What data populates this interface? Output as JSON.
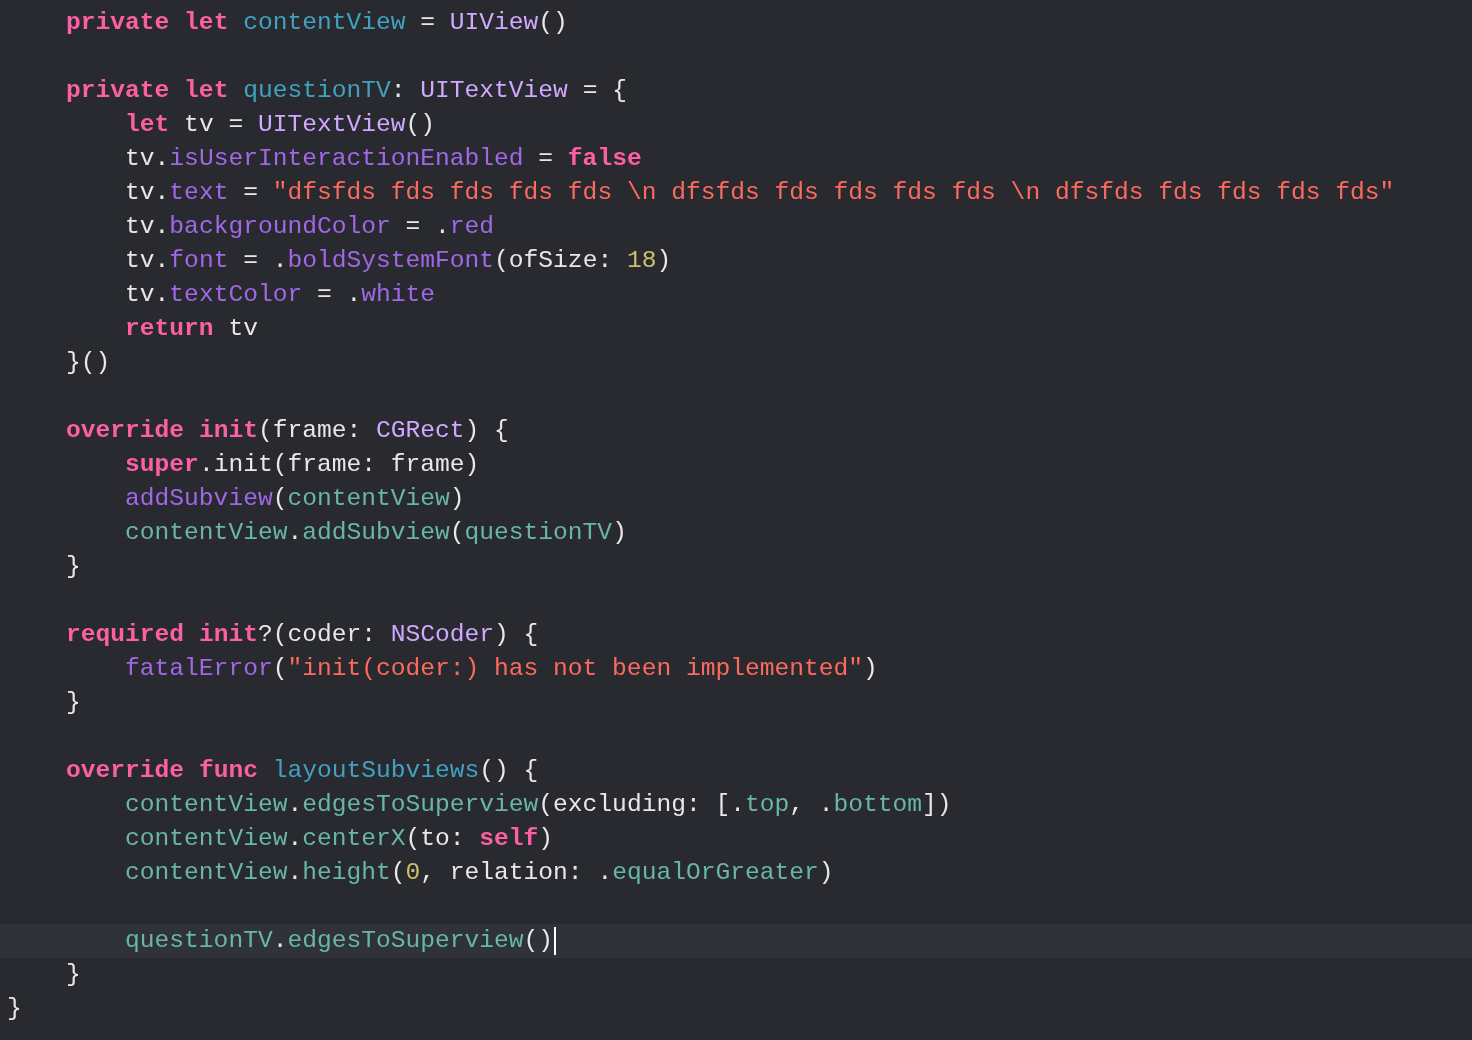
{
  "editor": {
    "lines": [
      {
        "current": false,
        "tokens": [
          {
            "kind": "keyword",
            "text": "    private "
          },
          {
            "kind": "keyword",
            "text": "let "
          },
          {
            "kind": "declaration",
            "text": "contentView"
          },
          {
            "kind": "plain",
            "text": " = "
          },
          {
            "kind": "type",
            "text": "UIView"
          },
          {
            "kind": "plain",
            "text": "()"
          }
        ]
      },
      {
        "current": false
      },
      {
        "current": false,
        "tokens": [
          {
            "kind": "keyword",
            "text": "    private "
          },
          {
            "kind": "keyword",
            "text": "let "
          },
          {
            "kind": "declaration",
            "text": "questionTV"
          },
          {
            "kind": "plain",
            "text": ": "
          },
          {
            "kind": "type",
            "text": "UITextView"
          },
          {
            "kind": "plain",
            "text": " = {"
          }
        ]
      },
      {
        "current": false,
        "tokens": [
          {
            "kind": "keyword",
            "text": "        let"
          },
          {
            "kind": "plain",
            "text": " tv = "
          },
          {
            "kind": "type",
            "text": "UITextView"
          },
          {
            "kind": "plain",
            "text": "()"
          }
        ]
      },
      {
        "current": false,
        "tokens": [
          {
            "kind": "plain",
            "text": "        tv."
          },
          {
            "kind": "system",
            "text": "isUserInteractionEnabled"
          },
          {
            "kind": "plain",
            "text": " = "
          },
          {
            "kind": "keyword",
            "text": "false"
          }
        ]
      },
      {
        "current": false,
        "tokens": [
          {
            "kind": "plain",
            "text": "        tv."
          },
          {
            "kind": "system",
            "text": "text"
          },
          {
            "kind": "plain",
            "text": " = "
          },
          {
            "kind": "string",
            "text": "\"dfsfds fds fds fds fds \\n dfsfds fds fds fds fds \\n dfsfds fds fds fds fds\""
          }
        ]
      },
      {
        "current": false,
        "tokens": [
          {
            "kind": "plain",
            "text": "        tv."
          },
          {
            "kind": "system",
            "text": "backgroundColor"
          },
          {
            "kind": "plain",
            "text": " = ."
          },
          {
            "kind": "system",
            "text": "red"
          }
        ]
      },
      {
        "current": false,
        "tokens": [
          {
            "kind": "plain",
            "text": "        tv."
          },
          {
            "kind": "system",
            "text": "font"
          },
          {
            "kind": "plain",
            "text": " = ."
          },
          {
            "kind": "system",
            "text": "boldSystemFont"
          },
          {
            "kind": "plain",
            "text": "(ofSize: "
          },
          {
            "kind": "number",
            "text": "18"
          },
          {
            "kind": "plain",
            "text": ")"
          }
        ]
      },
      {
        "current": false,
        "tokens": [
          {
            "kind": "plain",
            "text": "        tv."
          },
          {
            "kind": "system",
            "text": "textColor"
          },
          {
            "kind": "plain",
            "text": " = ."
          },
          {
            "kind": "system",
            "text": "white"
          }
        ]
      },
      {
        "current": false,
        "tokens": [
          {
            "kind": "keyword",
            "text": "        return"
          },
          {
            "kind": "plain",
            "text": " tv"
          }
        ]
      },
      {
        "current": false,
        "tokens": [
          {
            "kind": "plain",
            "text": "    }()"
          }
        ]
      },
      {
        "current": false
      },
      {
        "current": false,
        "tokens": [
          {
            "kind": "keyword",
            "text": "    override "
          },
          {
            "kind": "keyword",
            "text": "init"
          },
          {
            "kind": "plain",
            "text": "(frame: "
          },
          {
            "kind": "type",
            "text": "CGRect"
          },
          {
            "kind": "plain",
            "text": ") {"
          }
        ]
      },
      {
        "current": false,
        "tokens": [
          {
            "kind": "keyword",
            "text": "        super"
          },
          {
            "kind": "plain",
            "text": ".init(frame: frame)"
          }
        ]
      },
      {
        "current": false,
        "tokens": [
          {
            "kind": "system",
            "text": "        addSubview"
          },
          {
            "kind": "plain",
            "text": "("
          },
          {
            "kind": "project",
            "text": "contentView"
          },
          {
            "kind": "plain",
            "text": ")"
          }
        ]
      },
      {
        "current": false,
        "tokens": [
          {
            "kind": "project",
            "text": "        contentView"
          },
          {
            "kind": "plain",
            "text": "."
          },
          {
            "kind": "project",
            "text": "addSubview"
          },
          {
            "kind": "plain",
            "text": "("
          },
          {
            "kind": "project",
            "text": "questionTV"
          },
          {
            "kind": "plain",
            "text": ")"
          }
        ]
      },
      {
        "current": false,
        "tokens": [
          {
            "kind": "plain",
            "text": "    }"
          }
        ]
      },
      {
        "current": false
      },
      {
        "current": false,
        "tokens": [
          {
            "kind": "keyword",
            "text": "    required "
          },
          {
            "kind": "keyword",
            "text": "init"
          },
          {
            "kind": "plain",
            "text": "?(coder: "
          },
          {
            "kind": "type",
            "text": "NSCoder"
          },
          {
            "kind": "plain",
            "text": ") {"
          }
        ]
      },
      {
        "current": false,
        "tokens": [
          {
            "kind": "system",
            "text": "        fatalError"
          },
          {
            "kind": "plain",
            "text": "("
          },
          {
            "kind": "string",
            "text": "\"init(coder:) has not been implemented\""
          },
          {
            "kind": "plain",
            "text": ")"
          }
        ]
      },
      {
        "current": false,
        "tokens": [
          {
            "kind": "plain",
            "text": "    }"
          }
        ]
      },
      {
        "current": false
      },
      {
        "current": false,
        "tokens": [
          {
            "kind": "keyword",
            "text": "    override "
          },
          {
            "kind": "keyword",
            "text": "func "
          },
          {
            "kind": "declaration",
            "text": "layoutSubviews"
          },
          {
            "kind": "plain",
            "text": "() {"
          }
        ]
      },
      {
        "current": false,
        "tokens": [
          {
            "kind": "project",
            "text": "        contentView"
          },
          {
            "kind": "plain",
            "text": "."
          },
          {
            "kind": "project",
            "text": "edgesToSuperview"
          },
          {
            "kind": "plain",
            "text": "(excluding: [."
          },
          {
            "kind": "project",
            "text": "top"
          },
          {
            "kind": "plain",
            "text": ", ."
          },
          {
            "kind": "project",
            "text": "bottom"
          },
          {
            "kind": "plain",
            "text": "])"
          }
        ]
      },
      {
        "current": false,
        "tokens": [
          {
            "kind": "project",
            "text": "        contentView"
          },
          {
            "kind": "plain",
            "text": "."
          },
          {
            "kind": "project",
            "text": "centerX"
          },
          {
            "kind": "plain",
            "text": "(to: "
          },
          {
            "kind": "keyword",
            "text": "self"
          },
          {
            "kind": "plain",
            "text": ")"
          }
        ]
      },
      {
        "current": false,
        "tokens": [
          {
            "kind": "project",
            "text": "        contentView"
          },
          {
            "kind": "plain",
            "text": "."
          },
          {
            "kind": "project",
            "text": "height"
          },
          {
            "kind": "plain",
            "text": "("
          },
          {
            "kind": "number",
            "text": "0"
          },
          {
            "kind": "plain",
            "text": ", relation: ."
          },
          {
            "kind": "project",
            "text": "equalOrGreater"
          },
          {
            "kind": "plain",
            "text": ")"
          }
        ]
      },
      {
        "current": false
      },
      {
        "current": true,
        "tokens": [
          {
            "kind": "project",
            "text": "        questionTV"
          },
          {
            "kind": "plain",
            "text": "."
          },
          {
            "kind": "project",
            "text": "edgesToSuperview"
          },
          {
            "kind": "plain",
            "text": "()"
          }
        ]
      },
      {
        "current": false,
        "tokens": [
          {
            "kind": "plain",
            "text": "    }"
          }
        ]
      },
      {
        "current": false,
        "tokens": [
          {
            "kind": "plain",
            "text": "}"
          }
        ]
      }
    ]
  }
}
